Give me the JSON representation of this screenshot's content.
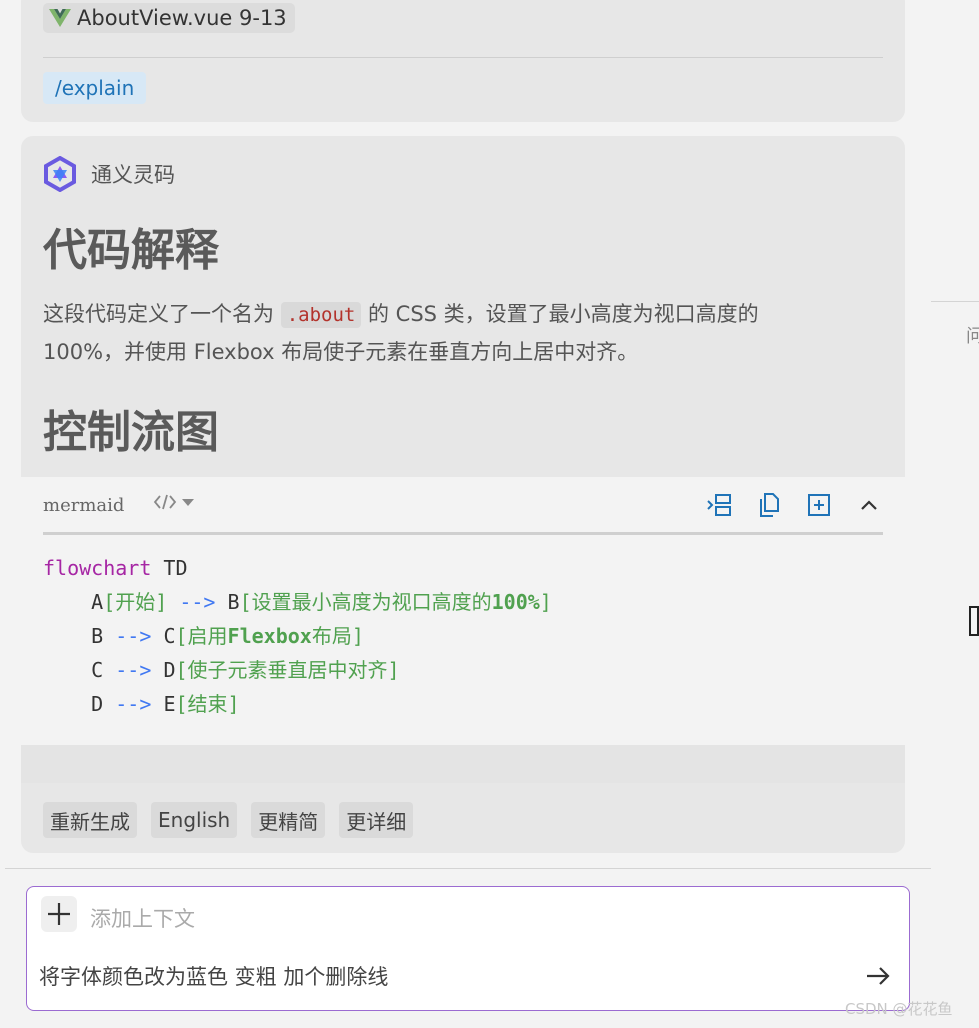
{
  "user_message": {
    "file_chip": "AboutView.vue 9-13",
    "command": "/explain"
  },
  "ai_message": {
    "assistant_name": "通义灵码",
    "heading_1": "代码解释",
    "paragraph_before": "这段代码定义了一个名为 ",
    "inline_code": ".about",
    "paragraph_after": " 的 CSS 类，设置了最小高度为视口高度的 100%，并使用 Flexbox 布局使子元素在垂直方向上居中对齐。",
    "heading_2": "控制流图",
    "code_block": {
      "language": "mermaid",
      "line1": {
        "kw": "flowchart",
        "rest": " TD"
      },
      "line2": {
        "indent": "    A",
        "str_a": "[开始]",
        "arrow": " --> ",
        "node": "B",
        "str_b_pre": "[设置最小高度为视口高度的",
        "str_b_bold": "100%",
        "str_b_post": "]"
      },
      "line3": {
        "indent": "    B",
        "arrow": " --> ",
        "node": "C",
        "str_pre": "[启用",
        "str_bold": "Flexbox",
        "str_post": "布局]"
      },
      "line4": {
        "indent": "    C",
        "arrow": " --> ",
        "node": "D",
        "str": "[使子元素垂直居中对齐]"
      },
      "line5": {
        "indent": "    D",
        "arrow": " --> ",
        "node": "E",
        "str": "[结束]"
      }
    },
    "actions": [
      "重新生成",
      "English",
      "更精简",
      "更详细"
    ]
  },
  "input": {
    "context_placeholder": "添加上下文",
    "text": "将字体颜色改为蓝色 变粗 加个删除线"
  },
  "sidebar_glyph": "问",
  "watermark": "CSDN @花花鱼",
  "colors": {
    "accent_purple": "#9b6bd1",
    "link_blue": "#1f73b7",
    "code_keyword": "#a626a4",
    "code_arrow": "#4078f2",
    "code_string": "#50a14f"
  }
}
